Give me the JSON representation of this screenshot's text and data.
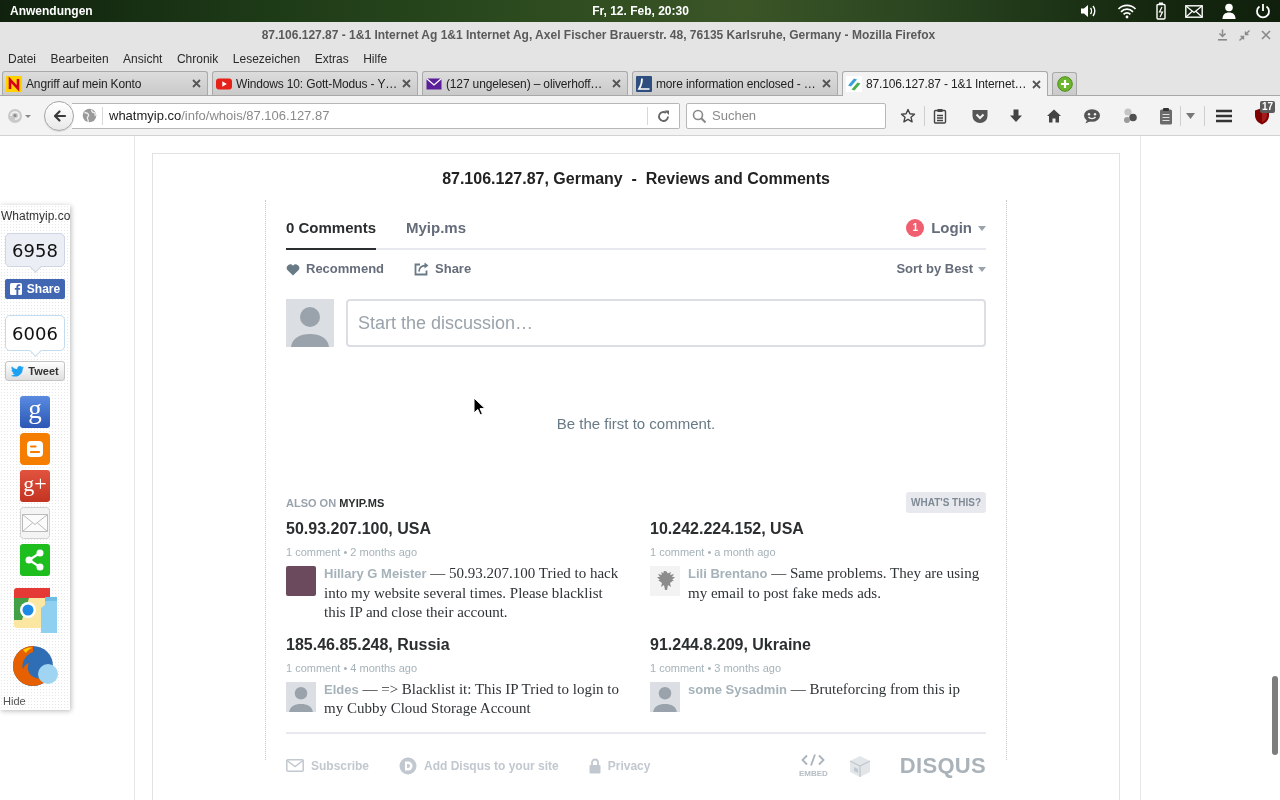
{
  "desktop_panel": {
    "menu": "Anwendungen",
    "clock": "Fr, 12. Feb, 20:30"
  },
  "window": {
    "title": "87.106.127.87 - 1&1 Internet Ag 1&1 Internet Ag, Axel Fischer Brauerstr. 48, 76135 Karlsruhe, Germany - Mozilla Firefox"
  },
  "menu_bar": [
    "Datei",
    "Bearbeiten",
    "Ansicht",
    "Chronik",
    "Lesezeichen",
    "Extras",
    "Hilfe"
  ],
  "tabs": [
    {
      "kind": "news",
      "label": "Angriff auf mein Konto",
      "selected": false
    },
    {
      "kind": "video",
      "label": "Windows 10: Gott-Modus - Y…",
      "selected": false
    },
    {
      "kind": "mail",
      "label": "(127 ungelesen) – oliverhoff…",
      "selected": false
    },
    {
      "kind": "document",
      "label": "more information enclosed - …",
      "selected": false
    },
    {
      "kind": "site",
      "label": "87.106.127.87 - 1&1 Internet…",
      "selected": true
    }
  ],
  "toolbar": {
    "url": {
      "host": "whatmyip.co",
      "path": "/info/whois/87.106.127.87"
    },
    "search": {
      "placeholder": "Suchen"
    },
    "addon_badge": "17"
  },
  "share_bar": {
    "site": "Whatmyip.co",
    "counters": [
      {
        "kind": "facebook",
        "count": "6958",
        "label": "Share"
      },
      {
        "kind": "twitter",
        "count": "6006",
        "label": "Tweet"
      }
    ],
    "services": [
      {
        "kind": "google",
        "glyph": "g"
      },
      {
        "kind": "blogger"
      },
      {
        "kind": "googleplus",
        "glyph": "g+"
      },
      {
        "kind": "email"
      },
      {
        "kind": "share"
      },
      {
        "kind": "chrome"
      },
      {
        "kind": "firefox"
      }
    ],
    "hide": "Hide"
  },
  "page": {
    "heading": "87.106.127.87, Germany  -  Reviews and Comments"
  },
  "comments": {
    "tabs": [
      {
        "label": "0 Comments",
        "selected": true
      },
      {
        "label": "Myip.ms",
        "selected": false
      }
    ],
    "notifications": "1",
    "login": "Login",
    "recommend": "Recommend",
    "share": "Share",
    "sort": "Sort by Best",
    "composer": {
      "placeholder": "Start the discussion…"
    },
    "empty_message": "Be the first to comment."
  },
  "also_on": {
    "label": "ALSO ON",
    "site": "MYIP.MS",
    "help": "WHAT'S THIS?",
    "discussions": [
      {
        "kind": "photo",
        "title": "50.93.207.100, USA",
        "meta": "1 comment • 2 months ago",
        "author": "Hillary G Meister",
        "excerpt": "— 50.93.207.100 Tried to hack into my website several times. Please blacklist this IP and close their account."
      },
      {
        "kind": "emblem",
        "title": "10.242.224.152, USA",
        "meta": "1 comment • a month ago",
        "author": "Lili Brentano",
        "excerpt": "— Same problems. They are using my email to post fake meds ads."
      },
      {
        "kind": "default",
        "title": "185.46.85.248, Russia",
        "meta": "1 comment • 4 months ago",
        "author": "Eldes",
        "excerpt": "— => Blacklist it: This IP Tried to login to my Cubby Cloud Storage Account"
      },
      {
        "kind": "default",
        "title": "91.244.8.209, Ukraine",
        "meta": "1 comment • 3 months ago",
        "author": "some Sysadmin",
        "excerpt": "— Bruteforcing from this ip"
      }
    ]
  },
  "footer": {
    "subscribe": "Subscribe",
    "add_disqus": "Add Disqus to your site",
    "privacy": "Privacy",
    "embed": "EMBED",
    "logo": "DISQUS"
  }
}
